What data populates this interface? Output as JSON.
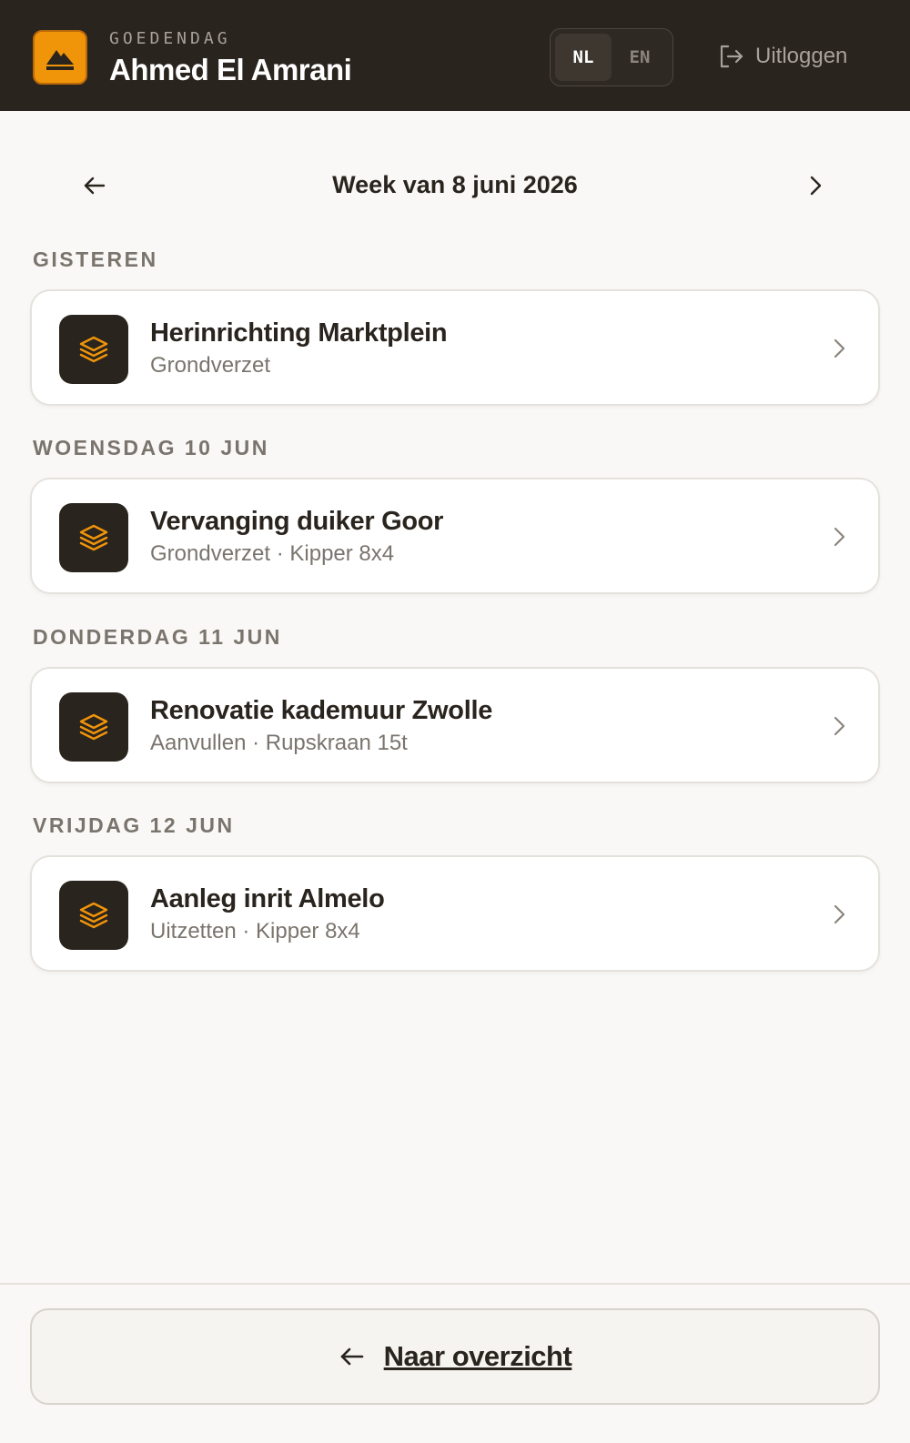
{
  "header": {
    "greeting": "GOEDENDAG",
    "username": "Ahmed El Amrani",
    "languages": [
      {
        "label": "NL",
        "active": true
      },
      {
        "label": "EN",
        "active": false
      }
    ],
    "logout_label": "Uitloggen",
    "logo_icon": "mountain-icon"
  },
  "week_nav": {
    "title": "Week van 8 juni 2026",
    "prev_icon": "arrow-left-icon",
    "next_icon": "chevron-right-icon"
  },
  "days": [
    {
      "label": "GISTEREN",
      "jobs": [
        {
          "title": "Herinrichting Marktplein",
          "subtitle": "Grondverzet",
          "icon": "layers-icon"
        }
      ]
    },
    {
      "label": "WOENSDAG 10 JUN",
      "jobs": [
        {
          "title": "Vervanging duiker Goor",
          "subtitle": "Grondverzet · Kipper 8x4",
          "icon": "layers-icon"
        }
      ]
    },
    {
      "label": "DONDERDAG 11 JUN",
      "jobs": [
        {
          "title": "Renovatie kademuur Zwolle",
          "subtitle": "Aanvullen · Rupskraan 15t",
          "icon": "layers-icon"
        }
      ]
    },
    {
      "label": "VRIJDAG 12 JUN",
      "jobs": [
        {
          "title": "Aanleg inrit Almelo",
          "subtitle": "Uitzetten · Kipper 8x4",
          "icon": "layers-icon"
        }
      ]
    }
  ],
  "footer": {
    "back_label": "Naar overzicht",
    "back_icon": "arrow-left-icon"
  },
  "colors": {
    "header_bg": "#2a241e",
    "accent": "#f0940a",
    "page_bg": "#f9f8f6",
    "muted_text": "#7a746d"
  }
}
